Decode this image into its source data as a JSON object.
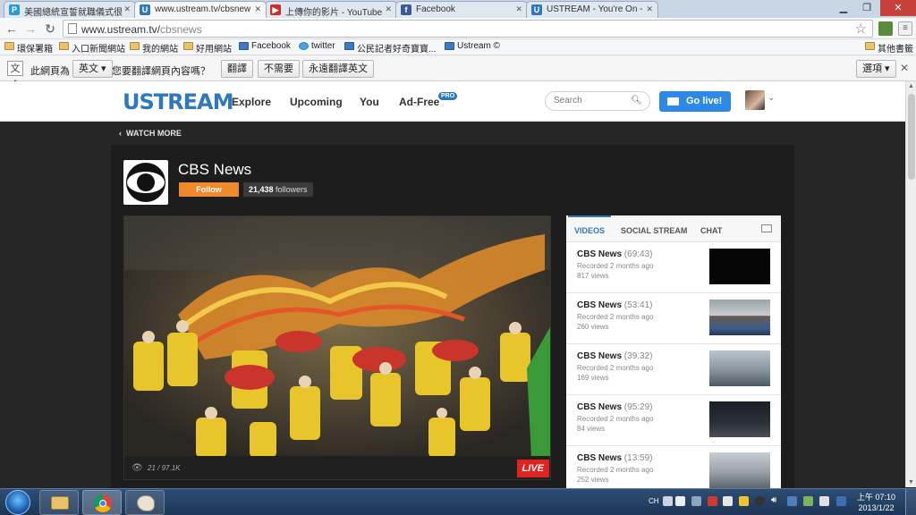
{
  "browser": {
    "tabs": [
      {
        "label": "美國總統宣誓就職儀式很",
        "favicon": "P",
        "color": "#2a9bd8"
      },
      {
        "label": "www.ustream.tv/cbsnew",
        "favicon": "U",
        "color": "#2e78bd"
      },
      {
        "label": "上傳你的影片 - YouTube",
        "favicon": "▶",
        "color": "#d32b2b"
      },
      {
        "label": "Facebook",
        "favicon": "f",
        "color": "#3b5998"
      },
      {
        "label": "USTREAM - You're On -",
        "favicon": "U",
        "color": "#2e78bd"
      }
    ],
    "url_host": "www.ustream.tv/",
    "url_path": "cbsnews",
    "bookmarks": [
      "環保署箱",
      "入口新聞網站",
      "我的網站",
      "好用網站",
      "Facebook",
      "twitter",
      "公民記者好奇寶寶...",
      "Ustream ©"
    ],
    "other_bookmarks": "其他書籤"
  },
  "translate": {
    "prefix": "此網頁為",
    "language": "英文",
    "question": "您要翻譯網頁內容嗎？",
    "translate": "翻譯",
    "no": "不需要",
    "always": "永遠翻譯英文",
    "options": "選項"
  },
  "ustream": {
    "logo": "USTREAM",
    "nav": [
      "Explore",
      "Upcoming",
      "You",
      "Ad-Free"
    ],
    "pro_badge": "PRO",
    "search_placeholder": "Search",
    "golive": "Go live!"
  },
  "channel": {
    "watch_more": "WATCH MORE",
    "name": "CBS News",
    "follow": "Follow",
    "followers_count": "21,438",
    "followers_label": "followers",
    "viewer_count": "21 / 97.1K",
    "live": "LIVE"
  },
  "sidebar": {
    "tabs": [
      "VIDEOS",
      "SOCIAL STREAM",
      "CHAT"
    ],
    "videos": [
      {
        "title": "CBS News",
        "duration": "(69:43)",
        "recorded": "Recorded 2 months ago",
        "views": "817 views"
      },
      {
        "title": "CBS News",
        "duration": "(53:41)",
        "recorded": "Recorded 2 months ago",
        "views": "260 views"
      },
      {
        "title": "CBS News",
        "duration": "(39:32)",
        "recorded": "Recorded 2 months ago",
        "views": "169 views"
      },
      {
        "title": "CBS News",
        "duration": "(95:29)",
        "recorded": "Recorded 2 months ago",
        "views": "84 views"
      },
      {
        "title": "CBS News",
        "duration": "(13:59)",
        "recorded": "Recorded 2 months ago",
        "views": "252 views"
      }
    ]
  },
  "taskbar": {
    "lang": "CH",
    "time": "上午 07:10",
    "date": "2013/1/22"
  }
}
